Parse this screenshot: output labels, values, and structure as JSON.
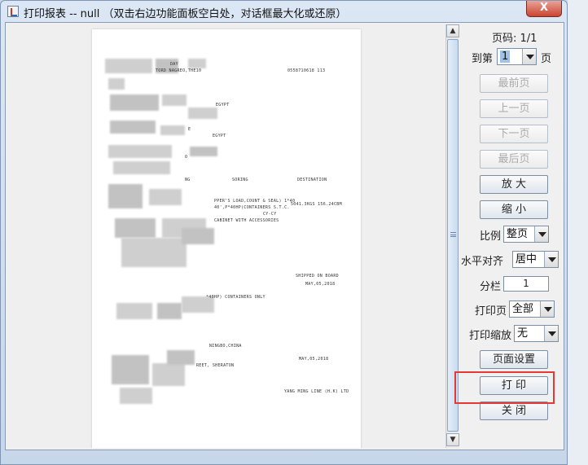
{
  "window": {
    "title": "打印报表 -- null （双击右边功能面板空白处，对话框最大化或还原）",
    "close_label": "X"
  },
  "preview": {
    "lines": [
      "DAY",
      "TORD        NAGREO,THE10",
      "0558710618 113",
      "EGYPT",
      "E",
      "EGYPT",
      "O",
      "NG",
      "SORING",
      "DESTINATION",
      "PPER'S LOAD,COUNT & SEAL) 1*40",
      "5041.3KGS     156.24CBM",
      "40',P*40HP(CONTAINERS S.T.C.",
      "CY-CY",
      "CABINET WITH ACCESSORIES",
      "SHIPPED ON BOARD",
      "MAY,05,2018",
      "*40HP) CONTAINERS ONLY",
      "NINGBO,CHINA",
      "MAY,05,2018",
      "REET, SHERATON",
      "YANG MING LINE (H.K) LTD"
    ]
  },
  "panel": {
    "page_label": "页码: 1/1",
    "goto_prefix": "到第",
    "goto_value": "1",
    "goto_suffix": "页",
    "first_page": "最前页",
    "prev_page": "上一页",
    "next_page": "下一页",
    "last_page": "最后页",
    "zoom_in": "放 大",
    "zoom_out": "缩 小",
    "scale_label": "比例",
    "scale_value": "整页",
    "halign_label": "水平对齐",
    "halign_value": "居中",
    "columns_label": "分栏",
    "columns_value": "1",
    "print_pages_label": "打印页",
    "print_pages_value": "全部",
    "print_scale_label": "打印缩放",
    "print_scale_value": "无",
    "page_setup": "页面设置",
    "print": "打 印",
    "close": "关 闭"
  },
  "colors": {
    "highlight_border": "#e53935",
    "close_button": "#c9452f",
    "selection": "#9ec3ea"
  },
  "icons": {
    "app": "java-app-icon",
    "scroll_up": "arrow-up-icon",
    "scroll_down": "arrow-down-icon",
    "combo": "chevron-down-icon"
  }
}
